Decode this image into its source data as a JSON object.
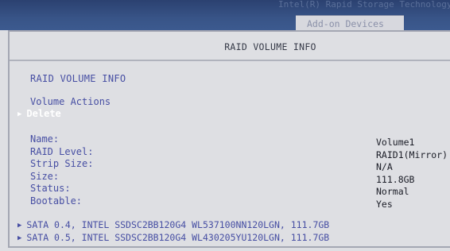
{
  "topbar": {
    "faint_text": "Intel(R) Rapid Storage Technology",
    "tab_label": "Add-on Devices"
  },
  "header": {
    "title": "RAID VOLUME INFO"
  },
  "section": {
    "title": "RAID VOLUME INFO",
    "actions_label": "Volume Actions",
    "delete_label": "Delete"
  },
  "fields": [
    {
      "label": "Name:",
      "value": "Volume1"
    },
    {
      "label": "RAID Level:",
      "value": "RAID1(Mirror)"
    },
    {
      "label": "Strip Size:",
      "value": "N/A"
    },
    {
      "label": "Size:",
      "value": "111.8GB"
    },
    {
      "label": "Status:",
      "value": "Normal"
    },
    {
      "label": "Bootable:",
      "value": "Yes"
    }
  ],
  "disks": [
    "SATA 0.4, INTEL SSDSC2BB120G4 WL537100NN120LGN, 111.7GB",
    "SATA 0.5, INTEL SSDSC2BB120G4 WL430205YU120LGN, 111.7GB"
  ],
  "colors": {
    "background": "#dedfe3",
    "topbar": "#385487",
    "label_blue": "#464ea3",
    "value_text": "#1a1c26",
    "selected_text": "#ffffff"
  }
}
